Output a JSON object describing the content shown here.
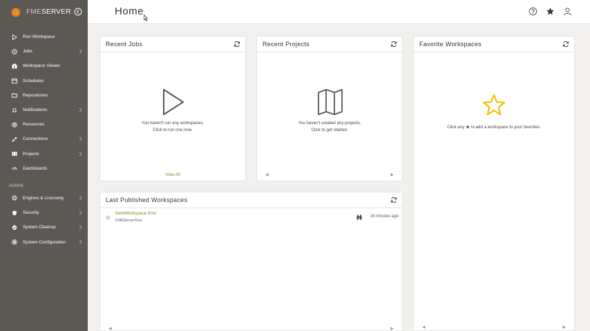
{
  "brand": {
    "prefix": "FME",
    "suffix": "SERVER"
  },
  "header": {
    "title": "Home"
  },
  "sidebar": {
    "items": [
      {
        "label": "Run Workspace",
        "icon": "play-icon"
      },
      {
        "label": "Jobs",
        "icon": "jobs-icon"
      },
      {
        "label": "Workspace Viewer",
        "icon": "viewer-icon"
      },
      {
        "label": "Schedules",
        "icon": "calendar-icon"
      },
      {
        "label": "Repositories",
        "icon": "folder-icon"
      },
      {
        "label": "Notifications",
        "icon": "bell-icon"
      },
      {
        "label": "Resources",
        "icon": "resources-icon"
      },
      {
        "label": "Connections",
        "icon": "connections-icon"
      },
      {
        "label": "Projects",
        "icon": "projects-icon"
      },
      {
        "label": "Dashboards",
        "icon": "dashboard-icon"
      }
    ],
    "admin_heading": "ADMIN",
    "admin_items": [
      {
        "label": "Engines & Licensing",
        "icon": "engine-icon"
      },
      {
        "label": "Security",
        "icon": "shield-icon"
      },
      {
        "label": "System Cleanup",
        "icon": "cleanup-icon"
      },
      {
        "label": "System Configuration",
        "icon": "gear-icon"
      }
    ]
  },
  "panels": {
    "recent_jobs": {
      "title": "Recent Jobs",
      "message_line1": "You haven't run any workspaces.",
      "message_line2": "Click to run one now.",
      "view_all": "View All"
    },
    "recent_projects": {
      "title": "Recent Projects",
      "message_line1": "You haven't created any projects.",
      "message_line2": "Click to get started."
    },
    "favorite_workspaces": {
      "title": "Favorite Workspaces",
      "message_pre": "Click any",
      "message_post": "to add a workspace to your favorites."
    },
    "last_published": {
      "title": "Last Published Workspaces",
      "rows": [
        {
          "name": "NewWorkspace.fmw",
          "repository": "FMEServerTour",
          "time": "16 minutes ago"
        }
      ]
    }
  },
  "colors": {
    "sidebar": "#5c5955",
    "accent_green": "#6c9a1c",
    "star_yellow": "#f2c200"
  }
}
